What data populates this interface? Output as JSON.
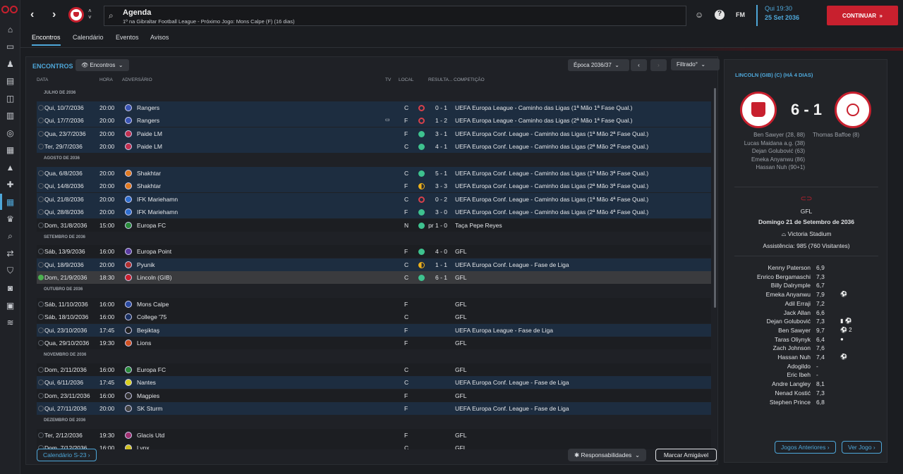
{
  "sidebar": {
    "icons": [
      "home-icon",
      "inbox-icon",
      "squad-icon",
      "team-report-icon",
      "dynamics-icon",
      "staff-icon",
      "tactics-icon",
      "data-hub-icon",
      "training-icon",
      "medical-icon",
      "calendar-icon",
      "competitions-icon",
      "scouting-icon",
      "transfers-icon",
      "club-vision-icon",
      "finances-icon",
      "dev-centre-icon",
      "shortlist-icon"
    ]
  },
  "topbar": {
    "search_title": "Agenda",
    "search_subtitle": "1º na Gibraltar Football League - Próximo Jogo: Mons Calpe (F) (16 dias)",
    "fm_label": "FM",
    "day_time": "Qui 19:30",
    "date": "25 Set 2036",
    "continue_label": "CONTINUAR"
  },
  "tabs": [
    "Encontros",
    "Calendário",
    "Eventos",
    "Avisos"
  ],
  "main": {
    "title": "ENCONTROS",
    "view_dropdown": "Encontros",
    "season": "Época 2036/37",
    "filter": "Filtrado",
    "columns": {
      "date": "DATA",
      "time": "HORA",
      "opponent": "ADVERSÁRIO",
      "tv": "TV",
      "venue": "LOCAL",
      "result": "RESULTA...",
      "competition": "COMPETIÇÃO"
    },
    "rows": [
      {
        "group": "JULHO DE 2036"
      },
      {
        "date": "Qui, 10/7/2036",
        "time": "20:00",
        "opp": "Rangers",
        "tv": "",
        "venue": "C",
        "res": "loss",
        "score": "0 - 1",
        "comp": "UEFA Europa League - Caminho das Ligas (1ª Mão 1ª Fase Qual.)",
        "style": "hl",
        "logo": "#3a55b5"
      },
      {
        "date": "Qui, 17/7/2036",
        "time": "20:00",
        "opp": "Rangers",
        "tv": "▭",
        "venue": "F",
        "res": "loss",
        "score": "1 - 2",
        "comp": "UEFA Europa League - Caminho das Ligas (2ª Mão 1ª Fase Qual.)",
        "style": "hl",
        "logo": "#3a55b5"
      },
      {
        "date": "Qua, 23/7/2036",
        "time": "20:00",
        "opp": "Paide LM",
        "tv": "",
        "venue": "F",
        "res": "win",
        "score": "3 - 1",
        "comp": "UEFA Europa Conf. League - Caminho das Ligas (1ª Mão 2ª Fase Qual.)",
        "style": "hl",
        "logo": "#c03050"
      },
      {
        "date": "Ter, 29/7/2036",
        "time": "20:00",
        "opp": "Paide LM",
        "tv": "",
        "venue": "C",
        "res": "win",
        "score": "4 - 1",
        "comp": "UEFA Europa Conf. League - Caminho das Ligas (2ª Mão 2ª Fase Qual.)",
        "style": "hl",
        "logo": "#c03050"
      },
      {
        "group": "AGOSTO DE 2036"
      },
      {
        "date": "Qua, 6/8/2036",
        "time": "20:00",
        "opp": "Shakhtar",
        "tv": "",
        "venue": "C",
        "res": "win",
        "score": "5 - 1",
        "comp": "UEFA Europa Conf. League - Caminho das Ligas (1ª Mão 3ª Fase Qual.)",
        "style": "hl",
        "logo": "#e07a20"
      },
      {
        "date": "Qui, 14/8/2036",
        "time": "20:00",
        "opp": "Shakhtar",
        "tv": "",
        "venue": "F",
        "res": "draw",
        "score": "3 - 3",
        "comp": "UEFA Europa Conf. League - Caminho das Ligas (2ª Mão 3ª Fase Qual.)",
        "style": "hl",
        "logo": "#e07a20"
      },
      {
        "date": "Qui, 21/8/2036",
        "time": "20:00",
        "opp": "IFK Mariehamn",
        "tv": "",
        "venue": "C",
        "res": "loss",
        "score": "0 - 2",
        "comp": "UEFA Europa Conf. League - Caminho das Ligas (1ª Mão 4ª Fase Qual.)",
        "style": "hl",
        "logo": "#2f6fd0"
      },
      {
        "date": "Qui, 28/8/2036",
        "time": "20:00",
        "opp": "IFK Mariehamn",
        "tv": "",
        "venue": "F",
        "res": "win",
        "score": "3 - 0",
        "comp": "UEFA Europa Conf. League - Caminho das Ligas (2ª Mão 4ª Fase Qual.)",
        "style": "hl",
        "logo": "#2f6fd0"
      },
      {
        "date": "Dom, 31/8/2036",
        "time": "15:00",
        "opp": "Europa FC",
        "tv": "",
        "venue": "N",
        "res": "win",
        "score": "pr 1 - 0",
        "comp": "Taça Pepe Reyes",
        "style": "dk",
        "logo": "#2a8a3a"
      },
      {
        "group": "SETEMBRO DE 2036"
      },
      {
        "date": "Sáb, 13/9/2036",
        "time": "16:00",
        "opp": "Europa Point",
        "tv": "",
        "venue": "F",
        "res": "win",
        "score": "4 - 0",
        "comp": "GFL",
        "style": "dk",
        "logo": "#5a3aa0"
      },
      {
        "date": "Qui, 18/9/2036",
        "time": "20:00",
        "opp": "Pyunik",
        "tv": "",
        "venue": "C",
        "res": "draw",
        "score": "1 - 1",
        "comp": "UEFA Europa Conf. League - Fase de Liga",
        "style": "hl",
        "logo": "#b03030"
      },
      {
        "date": "Dom, 21/9/2036",
        "time": "18:30",
        "opp": "Lincoln (GIB)",
        "tv": "",
        "venue": "C",
        "res": "win",
        "score": "6 - 1",
        "comp": "GFL",
        "style": "sel",
        "logo": "#c8202e"
      },
      {
        "group": "OUTUBRO DE 2036"
      },
      {
        "date": "Sáb, 11/10/2036",
        "time": "16:00",
        "opp": "Mons Calpe",
        "tv": "",
        "venue": "F",
        "res": "",
        "score": "",
        "comp": "GFL",
        "style": "dk",
        "logo": "#2a4aa0"
      },
      {
        "date": "Sáb, 18/10/2036",
        "time": "16:00",
        "opp": "College '75",
        "tv": "",
        "venue": "C",
        "res": "",
        "score": "",
        "comp": "GFL",
        "style": "dk",
        "logo": "#1a3060"
      },
      {
        "date": "Qui, 23/10/2036",
        "time": "17:45",
        "opp": "Beşiktaş",
        "tv": "",
        "venue": "F",
        "res": "",
        "score": "",
        "comp": "UEFA Europa League - Fase de Liga",
        "style": "hl",
        "logo": "#222222"
      },
      {
        "date": "Qua, 29/10/2036",
        "time": "19:30",
        "opp": "Lions",
        "tv": "",
        "venue": "F",
        "res": "",
        "score": "",
        "comp": "GFL",
        "style": "dk",
        "logo": "#d05020"
      },
      {
        "group": "NOVEMBRO DE 2036"
      },
      {
        "date": "Dom, 2/11/2036",
        "time": "16:00",
        "opp": "Europa FC",
        "tv": "",
        "venue": "C",
        "res": "",
        "score": "",
        "comp": "GFL",
        "style": "dk",
        "logo": "#2a8a3a"
      },
      {
        "date": "Qui, 6/11/2036",
        "time": "17:45",
        "opp": "Nantes",
        "tv": "",
        "venue": "C",
        "res": "",
        "score": "",
        "comp": "UEFA Europa Conf. League - Fase de Liga",
        "style": "hl",
        "logo": "#d8d020"
      },
      {
        "date": "Dom, 23/11/2036",
        "time": "16:00",
        "opp": "Magpies",
        "tv": "",
        "venue": "F",
        "res": "",
        "score": "",
        "comp": "GFL",
        "style": "dk",
        "logo": "#333333"
      },
      {
        "date": "Qui, 27/11/2036",
        "time": "20:00",
        "opp": "SK Sturm",
        "tv": "",
        "venue": "F",
        "res": "",
        "score": "",
        "comp": "UEFA Europa Conf. League - Fase de Liga",
        "style": "hl",
        "logo": "#444444"
      },
      {
        "group": "DEZEMBRO DE 2036"
      },
      {
        "date": "Ter, 2/12/2036",
        "time": "19:30",
        "opp": "Glacis Utd",
        "tv": "",
        "venue": "F",
        "res": "",
        "score": "",
        "comp": "GFL",
        "style": "dk",
        "logo": "#a03070"
      },
      {
        "date": "Dom, 7/12/2036",
        "time": "16:00",
        "opp": "Lynx",
        "tv": "",
        "venue": "C",
        "res": "",
        "score": "",
        "comp": "GFL",
        "style": "dk",
        "logo": "#d0c020"
      }
    ],
    "u23_calendar": "Calendário S-23",
    "responsibilities": "Responsabilidades",
    "friendly": "Marcar Amigável"
  },
  "side": {
    "header": "LINCOLN (GIB) (C) (HÁ 4 DIAS)",
    "score": "6 - 1",
    "home_scorers": [
      "Ben Sawyer (28, 88)",
      "Lucas Maidana a.g. (38)",
      "Dejan Golubović (63)",
      "Emeka Anyanwu (86)",
      "Hassan Nuh (90+1)"
    ],
    "away_scorers": [
      "Thomas Baffoe (8)"
    ],
    "competition": "GFL",
    "match_date": "Domingo 21 de Setembro de 2036",
    "stadium": "Victoria Stadium",
    "attendance": "Assistência: 985 (760 Visitantes)",
    "players": [
      {
        "name": "Kenny Paterson",
        "rating": "6,9",
        "ev": ""
      },
      {
        "name": "Enrico Bergamaschi",
        "rating": "7,3",
        "ev": ""
      },
      {
        "name": "Billy Dalrymple",
        "rating": "6,7",
        "ev": ""
      },
      {
        "name": "Emeka Anyanwu",
        "rating": "7,9",
        "ev": "⚽"
      },
      {
        "name": "Adil Erraji",
        "rating": "7,2",
        "ev": ""
      },
      {
        "name": "Jack Allan",
        "rating": "6,6",
        "ev": ""
      },
      {
        "name": "Dejan Golubović",
        "rating": "7,3",
        "ev": "▮ ⚽"
      },
      {
        "name": "Ben Sawyer",
        "rating": "9,7",
        "ev": "⚽ 2"
      },
      {
        "name": "Taras Oliynyk",
        "rating": "6,4",
        "ev": "●"
      },
      {
        "name": "Zach Johnson",
        "rating": "7,6",
        "ev": ""
      },
      {
        "name": "Hassan Nuh",
        "rating": "7,4",
        "ev": "⚽"
      },
      {
        "name": "Adogildo",
        "rating": "-",
        "ev": ""
      },
      {
        "name": "Eric Ibeh",
        "rating": "-",
        "ev": ""
      },
      {
        "name": "Andre Langley",
        "rating": "8,1",
        "ev": ""
      },
      {
        "name": "Nenad Kostić",
        "rating": "7,3",
        "ev": ""
      },
      {
        "name": "Stephen Prince",
        "rating": "6,8",
        "ev": ""
      }
    ],
    "prev_matches": "Jogos Anteriores",
    "view_match": "Ver Jogo"
  },
  "colors": {
    "accent": "#4ea7d9",
    "brand": "#c8202e",
    "win": "#3ec28f",
    "loss": "#d7414b",
    "draw": "#ecb11c"
  }
}
